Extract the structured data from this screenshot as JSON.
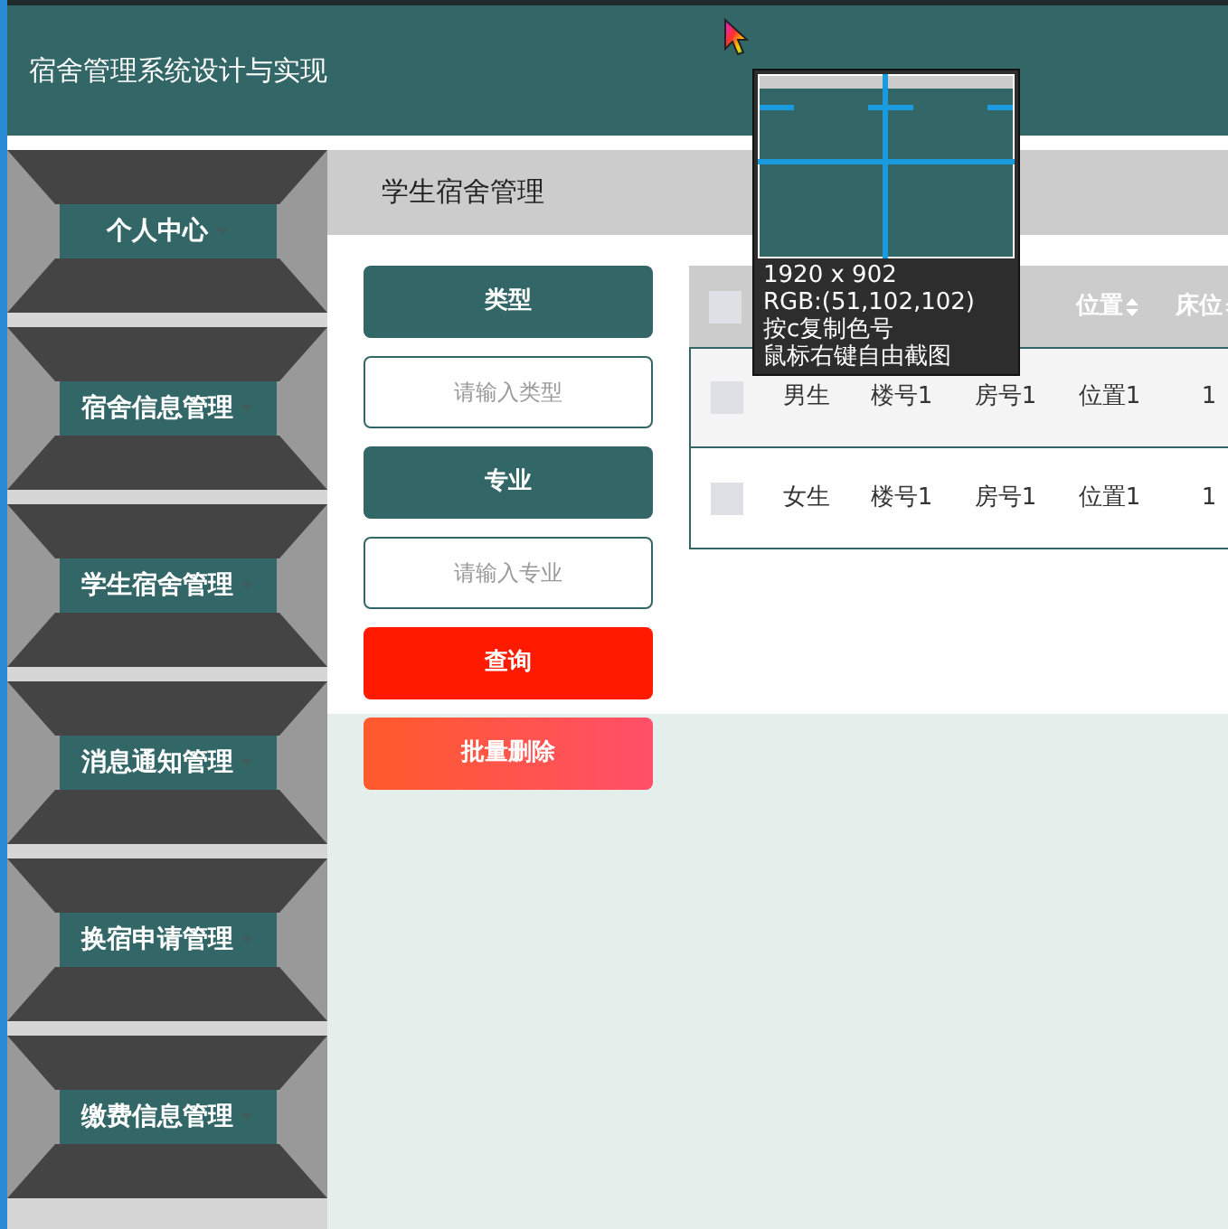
{
  "header": {
    "title": "宿舍管理系统设计与实现"
  },
  "sidebar": {
    "items": [
      {
        "label": "个人中心"
      },
      {
        "label": "宿舍信息管理"
      },
      {
        "label": "学生宿舍管理"
      },
      {
        "label": "消息通知管理"
      },
      {
        "label": "换宿申请管理"
      },
      {
        "label": "缴费信息管理"
      }
    ]
  },
  "breadcrumb": "学生宿舍管理",
  "search": {
    "fields": [
      {
        "label": "类型",
        "placeholder": "请输入类型"
      },
      {
        "label": "专业",
        "placeholder": "请输入专业"
      }
    ],
    "buttons": [
      {
        "label": "查询",
        "kind": "query"
      },
      {
        "label": "批量删除",
        "kind": "delete"
      }
    ]
  },
  "table": {
    "all_selected": false,
    "columns": [
      {},
      {},
      {},
      {
        "label": "位置"
      },
      {
        "label": "床位"
      }
    ],
    "rows": [
      {
        "selected": false,
        "cells": [
          "男生",
          "楼号1",
          "房号1",
          "位置1",
          "1"
        ]
      },
      {
        "selected": false,
        "cells": [
          "女生",
          "楼号1",
          "房号1",
          "位置1",
          "1"
        ]
      }
    ]
  },
  "color_picker": {
    "size": "1920 x 902",
    "rgb": "RGB:(51,102,102)",
    "hint_copy": "按c复制色号",
    "hint_capture": "鼠标右键自由截图"
  }
}
